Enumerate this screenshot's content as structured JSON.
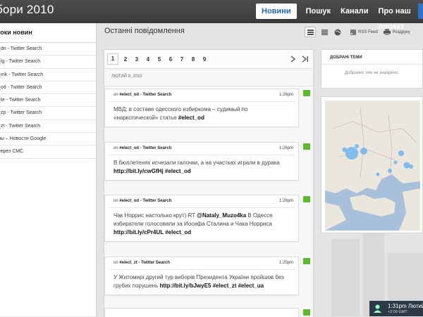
{
  "header": {
    "site_title": "бори 2010",
    "nav": [
      {
        "label": "Новини"
      },
      {
        "label": "Пошук"
      },
      {
        "label": "Канали"
      },
      {
        "label": "Про наш проект"
      }
    ]
  },
  "sidebar": {
    "title": "токи новин",
    "items": [
      {
        "label": "_dn - Twitter Search"
      },
      {
        "label": "_lg - Twitter Search"
      },
      {
        "label": "_mk - Twitter Search"
      },
      {
        "label": "_od - Twitter Search"
      },
      {
        "label": "_te - Twitter Search"
      },
      {
        "label": "_zp - Twitter Search"
      },
      {
        "label": "_zt - Twitter Search"
      },
      {
        "label": "ры – Новости Google"
      },
      {
        "label": "через СМС"
      }
    ]
  },
  "main": {
    "heading": "Останні повідомлення",
    "toolbar": {
      "rss_label": "RSS Feed",
      "print_label": "Роздруку"
    },
    "pager": {
      "pages": [
        "1",
        "2",
        "3",
        "4",
        "5",
        "6",
        "7",
        "8",
        "9"
      ],
      "current": "1"
    },
    "date_label": "Лютий 9, 2010",
    "posts": [
      {
        "source_prefix": "on ",
        "source": "#elect_od - Twitter Search",
        "time": "1:26pm",
        "text_plain": "МВД: в составе одесского избиркома – судимый по «наркотической» статье ",
        "text_bold": "#elect_od"
      },
      {
        "source_prefix": "on ",
        "source": "#elect_od - Twitter Search",
        "time": "1:26pm",
        "text_plain": "В бюллетенях исчезали галочки, а на участках играли в дурака ",
        "text_bold": "http://bit.ly/cwGfHj #elect_od"
      },
      {
        "source_prefix": "on ",
        "source": "#elect_od - Twitter Search",
        "time": "1:26pm",
        "text_plain": "Чак Норрис настолько крут) RT ",
        "text_mention": "@Nataly_Muzo4ka",
        "text_plain2": " В Одессе избиратели голосовали за Иосифа Сталина и Чака Норриса ",
        "text_bold": "http://bit.ly/cPr4UL #elect_od"
      },
      {
        "source_prefix": "on ",
        "source": "#elect_zt - Twitter Search",
        "time": "1:25pm",
        "text_plain": "У Житомирі другий тур виборів Президента України пройшов без грубих порушень ",
        "text_bold": "http://bit.ly/bJwyE5 #elect_zt #elect_ua"
      }
    ]
  },
  "right": {
    "themes_title": "ДОБРАНІ ТЕМИ",
    "themes_empty": "Добраних тем не знайдено."
  },
  "clock": {
    "time": "1:31pm Лютий",
    "tz": "+2:00 GMT"
  },
  "colors": {
    "topbar": "#3f3f3f",
    "active_nav_text": "#2266aa",
    "share_green": "#5cb82d",
    "map_water": "#9fb7d3",
    "map_land": "#e8e4da",
    "map_bubble": "#6fb4ee"
  }
}
